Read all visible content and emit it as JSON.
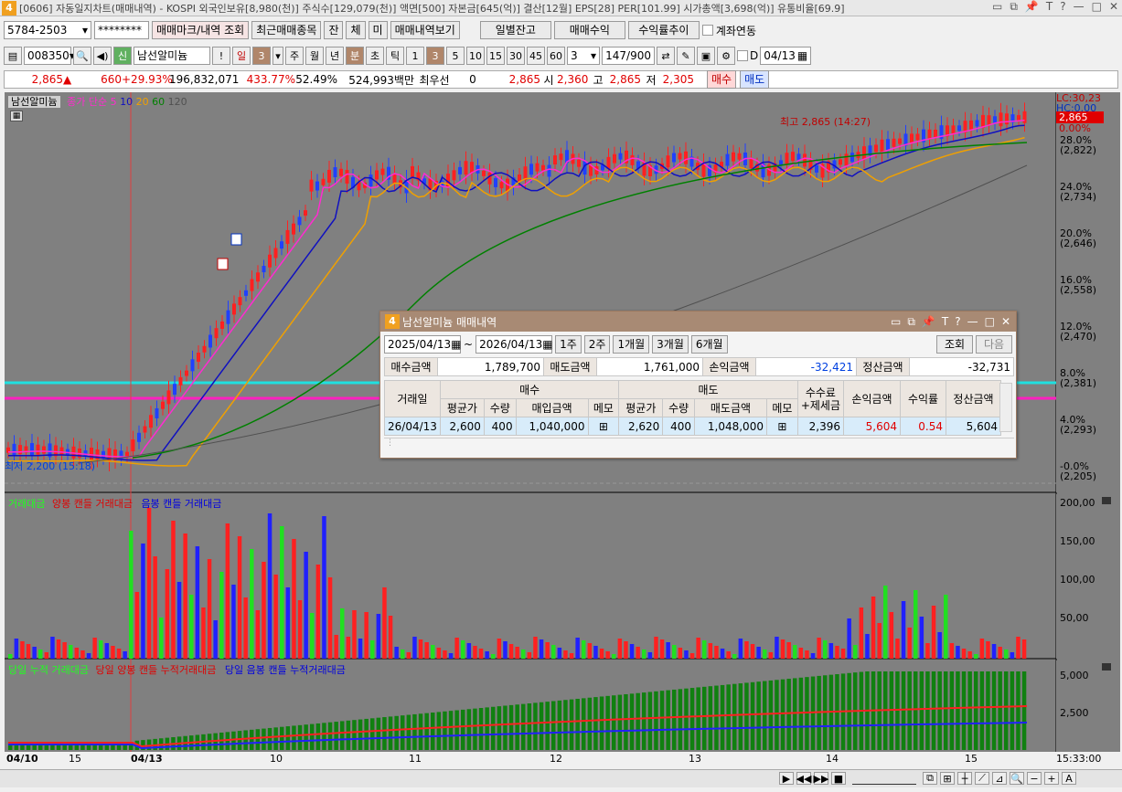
{
  "window": {
    "num": "4",
    "title": "[0606] 자동일지차트(매매내역) - KOSPI 외국인보유[8,980(천)] 주식수[129,079(천)] 액면[500] 자본금[645(억)] 결산[12월] EPS[28] PER[101.99] 시가총액[3,698(억)] 유통비율[69.9]",
    "icons": [
      "min",
      "restore",
      "pin",
      "T",
      "?",
      "dash",
      "max",
      "close"
    ]
  },
  "toolbar1": {
    "account": "5784-2503",
    "password": "********",
    "b1": "매매마크/내역 조회",
    "b2": "최근매매종목",
    "b3": "잔",
    "b4": "체",
    "b5": "미",
    "b6": "매매내역보기",
    "b7": "일별잔고",
    "b8": "매매수익",
    "b9": "수익률추이",
    "chk": "계좌연동"
  },
  "toolbar2": {
    "code": "008350",
    "badge": "신",
    "name": "남선알미늄",
    "excl": "!",
    "period": "일",
    "periodnum": "3",
    "p1": "주",
    "p2": "월",
    "p3": "년",
    "p4": "분",
    "p5": "초",
    "p6": "틱",
    "n1": "1",
    "n2": "3",
    "n3": "5",
    "n4": "10",
    "n5": "15",
    "n6": "30",
    "n7": "45",
    "n8": "60",
    "mins": "3",
    "count": "147",
    "countmax": "/900",
    "d": "D",
    "date": "04/13"
  },
  "quote": {
    "price": "2,865",
    "change": "660",
    "rate": "+29.93%",
    "volume": "196,832,071",
    "volrate": "433.77%",
    "ratio2": "52.49%",
    "amount": "524,993백만",
    "pref": "최우선",
    "prefval": "0",
    "ask": "2,865",
    "open_l": "시",
    "open": "2,360",
    "high_l": "고",
    "high": "2,865",
    "low_l": "저",
    "low": "2,305",
    "buy": "매수",
    "sell": "매도"
  },
  "chart": {
    "name": "남선알미늄",
    "legend_price": "종가 단순",
    "ma": [
      "5",
      "10",
      "20",
      "60",
      "120"
    ],
    "ma_colors": [
      "#ff2bd0",
      "#1010c0",
      "#f0a000",
      "#008000",
      "#404040"
    ],
    "high_label": "최고 2,865 (14:27)",
    "low_label": "최저 2,200 (15:18)",
    "lc": "LC:30,23",
    "hc": "HC:0.00",
    "cur": "2,865",
    "cur_pct": "0.00%",
    "yaxis": [
      [
        "28.0%",
        "(2,822)"
      ],
      [
        "24.0%",
        "(2,734)"
      ],
      [
        "20.0%",
        "(2,646)"
      ],
      [
        "16.0%",
        "(2,558)"
      ],
      [
        "12.0%",
        "(2,470)"
      ],
      [
        "8.0%",
        "(2,381)"
      ],
      [
        "4.0%",
        "(2,293)"
      ],
      [
        "-0.0%",
        "(2,205)"
      ]
    ],
    "vol_legend": [
      "거래대금",
      "양봉 캔들 거래대금",
      "음봉 캔들 거래대금"
    ],
    "vol_axis": [
      "200,00",
      "150,00",
      "100,00",
      "50,00"
    ],
    "cum_legend": [
      "당일 누적 거래대금",
      "당일 양봉 캔들 누적거래대금",
      "당일 음봉 캔들 누적거래대금"
    ],
    "cum_axis": [
      "5,000",
      "2,500"
    ],
    "xaxis": [
      "04/10",
      "15",
      "04/13",
      "10",
      "11",
      "12",
      "13",
      "14",
      "15"
    ],
    "time": "15:33:00"
  },
  "dialog": {
    "num": "4",
    "title": "남선알미늄 매매내역",
    "from": "2025/04/13",
    "tilde": "~",
    "to": "2026/04/13",
    "w1": "1주",
    "w2": "2주",
    "m1": "1개월",
    "m3": "3개월",
    "m6": "6개월",
    "query": "조회",
    "next": "다음",
    "sum": {
      "buy_l": "매수금액",
      "buy": "1,789,700",
      "sell_l": "매도금액",
      "sell": "1,761,000",
      "pl_l": "손익금액",
      "pl": "-32,421",
      "settle_l": "정산금액",
      "settle": "-32,731"
    },
    "head": {
      "date": "거래일",
      "buy": "매수",
      "sell": "매도",
      "fee": "수수료",
      "fee2": "+제세금",
      "pl": "손익금액",
      "rate": "수익률",
      "settle": "정산금액",
      "avg": "평균가",
      "qty": "수량",
      "bamt": "매입금액",
      "memo": "메모",
      "samt": "매도금액"
    },
    "row": {
      "date": "26/04/13",
      "bavg": "2,600",
      "bqty": "400",
      "bamt": "1,040,000",
      "savg": "2,620",
      "sqty": "400",
      "samt": "1,048,000",
      "fee": "2,396",
      "pl": "5,604",
      "rate": "0.54",
      "settle": "5,604"
    }
  }
}
